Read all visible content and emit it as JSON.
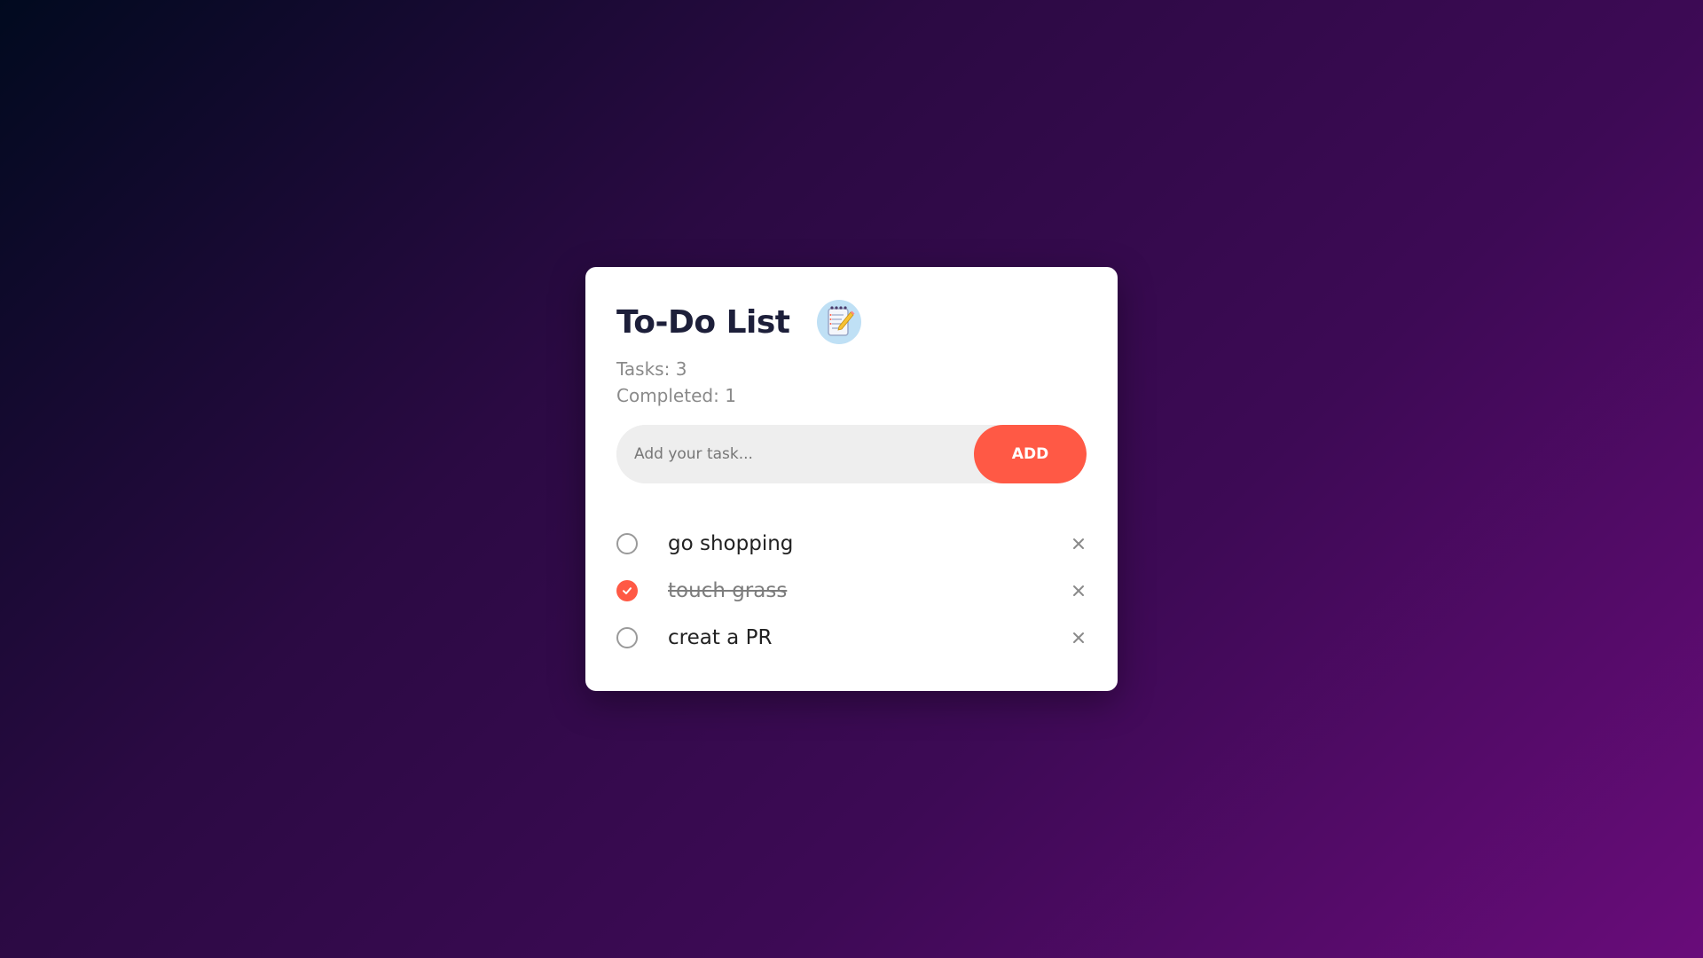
{
  "app": {
    "title": "To-Do List",
    "icon": "notepad-checklist-icon"
  },
  "stats": {
    "tasks_label": "Tasks:",
    "tasks_count": "3",
    "completed_label": "Completed:",
    "completed_count": "1"
  },
  "input": {
    "placeholder": "Add your task...",
    "value": "",
    "add_label": "ADD"
  },
  "tasks": [
    {
      "text": "go shopping",
      "completed": false
    },
    {
      "text": "touch grass",
      "completed": true
    },
    {
      "text": "creat a PR",
      "completed": false
    }
  ],
  "colors": {
    "accent": "#ff5945",
    "title": "#1d1f3a",
    "muted": "#8a8a8a",
    "card": "#ffffff",
    "input_bg": "#eeeeee"
  },
  "icons": {
    "unchecked": "empty-circle-icon",
    "checked": "check-circle-icon",
    "remove": "close-icon"
  }
}
